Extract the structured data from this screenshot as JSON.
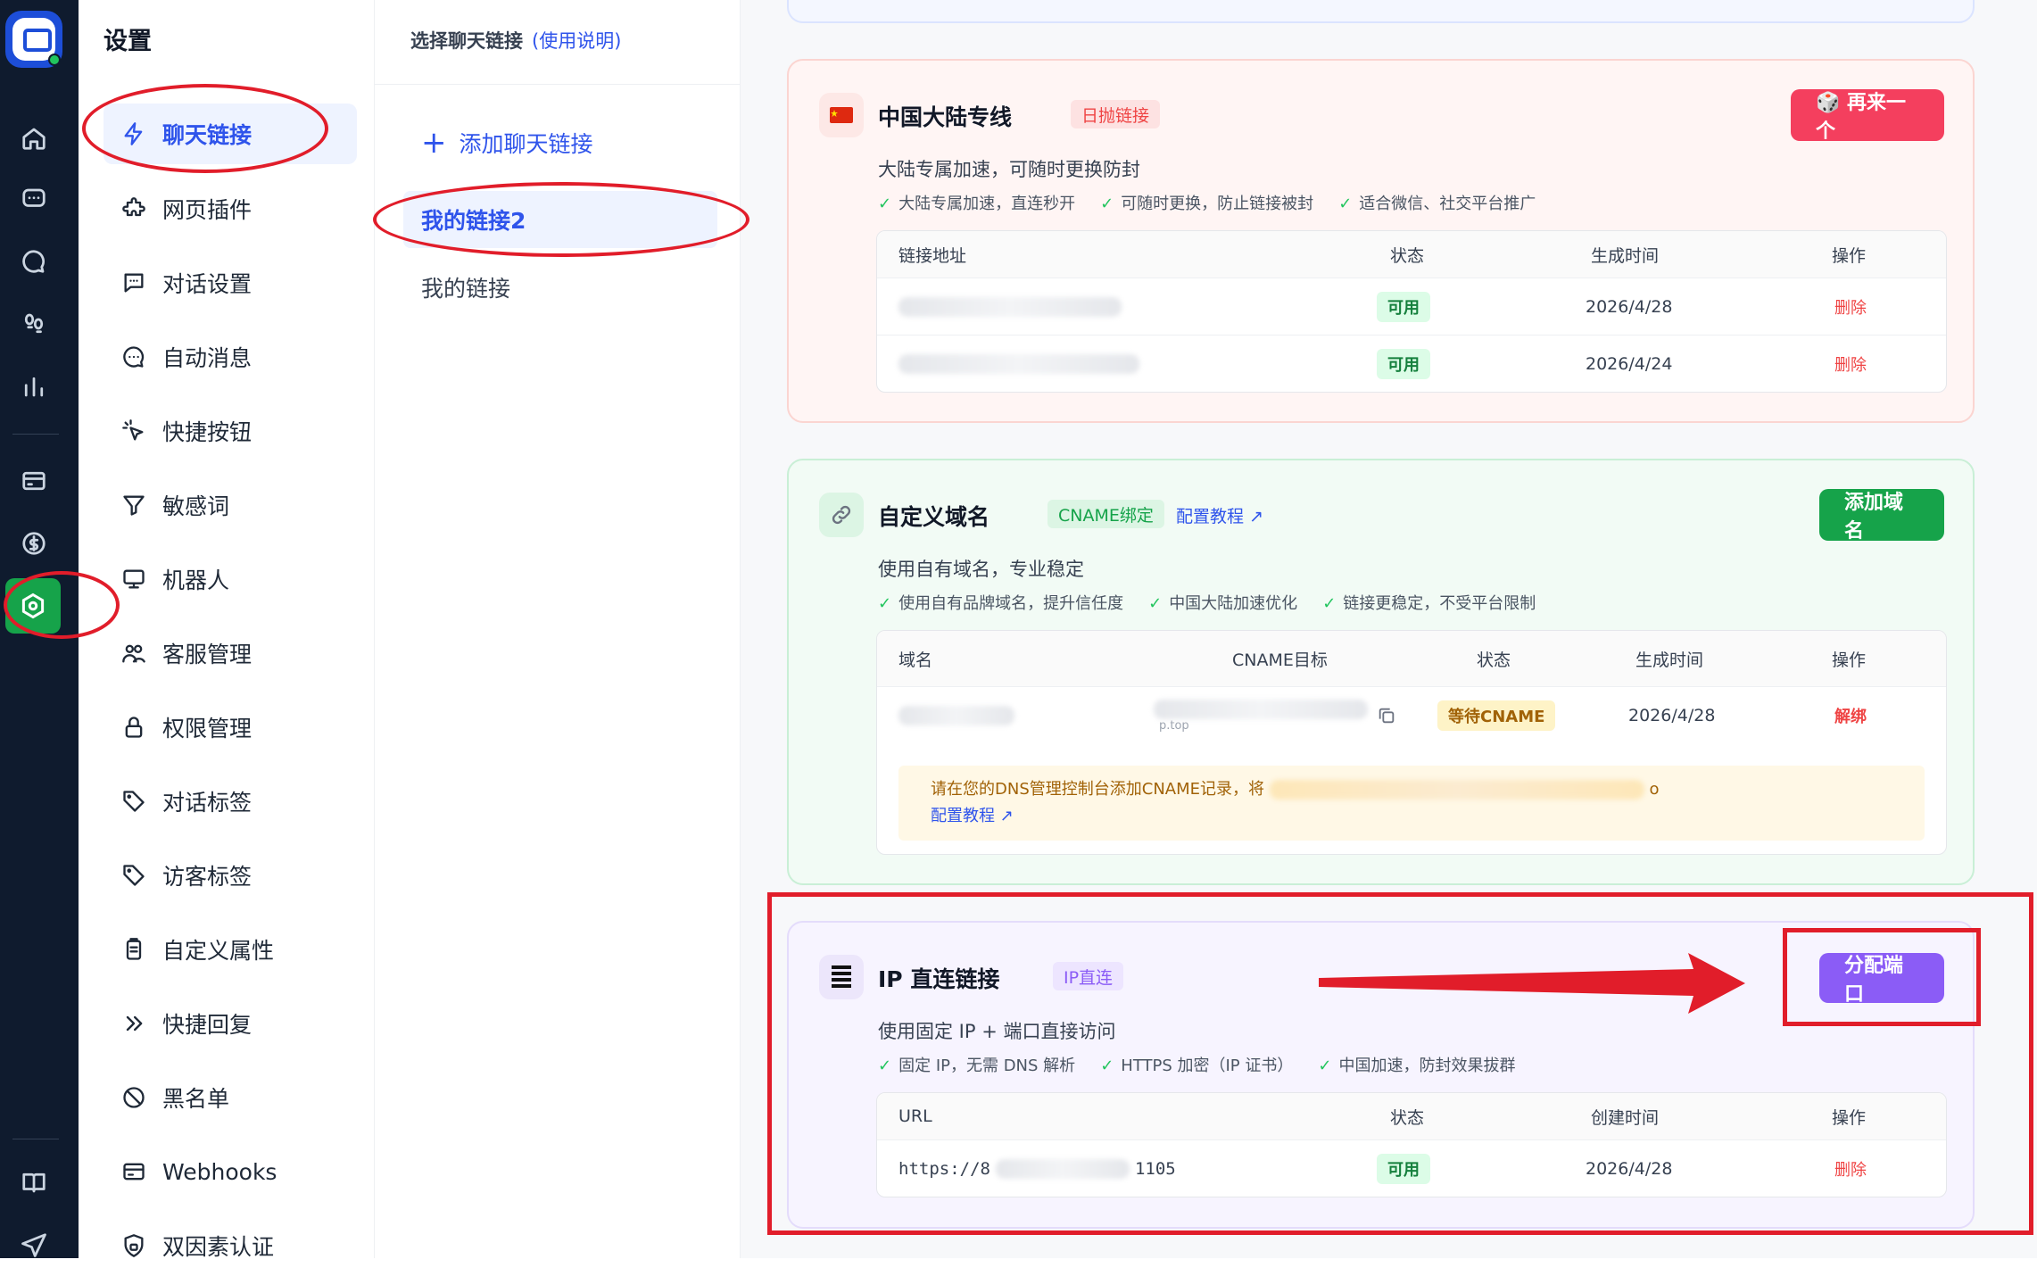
{
  "nav_rail": {
    "icons": [
      "home-icon",
      "chat-icon",
      "message-icon",
      "footprint-icon",
      "bar-chart-icon",
      "billing-icon",
      "dollar-icon",
      "settings-icon",
      "book-icon",
      "send-icon"
    ]
  },
  "settings_menu": {
    "title": "设置",
    "items": [
      {
        "label": "聊天链接",
        "icon": "bolt-icon",
        "active": true
      },
      {
        "label": "网页插件",
        "icon": "puzzle-icon"
      },
      {
        "label": "对话设置",
        "icon": "chat-settings-icon"
      },
      {
        "label": "自动消息",
        "icon": "auto-message-icon"
      },
      {
        "label": "快捷按钮",
        "icon": "cursor-click-icon"
      },
      {
        "label": "敏感词",
        "icon": "filter-icon"
      },
      {
        "label": "机器人",
        "icon": "monitor-icon"
      },
      {
        "label": "客服管理",
        "icon": "users-icon"
      },
      {
        "label": "权限管理",
        "icon": "lock-icon"
      },
      {
        "label": "对话标签",
        "icon": "tag-icon"
      },
      {
        "label": "访客标签",
        "icon": "tag-icon"
      },
      {
        "label": "自定义属性",
        "icon": "clipboard-icon"
      },
      {
        "label": "快捷回复",
        "icon": "double-chevron-icon"
      },
      {
        "label": "黑名单",
        "icon": "ban-icon"
      },
      {
        "label": "Webhooks",
        "icon": "webhook-icon"
      },
      {
        "label": "双因素认证",
        "icon": "shield-lock-icon"
      }
    ]
  },
  "links_panel": {
    "header": "选择聊天链接",
    "help": "(使用说明)",
    "add_label": "添加聊天链接",
    "add_icon": "plus-icon",
    "items": [
      {
        "label": "我的链接2",
        "active": true
      },
      {
        "label": "我的链接"
      }
    ]
  },
  "mainland": {
    "flag_icon": "china-flag-icon",
    "title": "中国大陆专线",
    "badge": "日抛链接",
    "button": "🎲 再来一个",
    "desc": "大陆专属加速，可随时更换防封",
    "features": [
      "大陆专属加速，直连秒开",
      "可随时更换，防止链接被封",
      "适合微信、社交平台推广"
    ],
    "columns": [
      "链接地址",
      "状态",
      "生成时间",
      "操作"
    ],
    "rows": [
      {
        "status": "可用",
        "date": "2026/4/28",
        "action": "删除"
      },
      {
        "status": "可用",
        "date": "2026/4/24",
        "action": "删除"
      }
    ]
  },
  "custom_domain": {
    "icon": "link-icon",
    "title": "自定义域名",
    "badge": "CNAME绑定",
    "tutorial": "配置教程",
    "button": "添加域名",
    "desc": "使用自有域名，专业稳定",
    "features": [
      "使用自有品牌域名，提升信任度",
      "中国大陆加速优化",
      "链接更稳定，不受平台限制"
    ],
    "columns": [
      "域名",
      "CNAME目标",
      "状态",
      "生成时间",
      "操作"
    ],
    "rows": [
      {
        "status": "等待CNAME",
        "date": "2026/4/28",
        "action": "解绑"
      }
    ],
    "cname_tail": "p.top",
    "notice": "请在您的DNS管理控制台添加CNAME记录，将",
    "notice_tail": "o",
    "notice_link": "配置教程"
  },
  "ip_direct": {
    "icon": "server-icon",
    "title": "IP 直连链接",
    "badge": "IP直连",
    "button": "分配端口",
    "desc": "使用固定 IP + 端口直接访问",
    "features": [
      "固定 IP，无需 DNS 解析",
      "HTTPS 加密（IP 证书）",
      "中国加速，防封效果拔群"
    ],
    "columns": [
      "URL",
      "状态",
      "创建时间",
      "操作"
    ],
    "rows": [
      {
        "url_prefix": "https://8",
        "url_suffix": "1105",
        "status": "可用",
        "date": "2026/4/28",
        "action": "删除"
      }
    ]
  },
  "colors": {
    "primary": "#2f54eb",
    "danger": "#ef4444",
    "success": "#22c55e",
    "purple": "#8b5cf6",
    "annotation": "#e11d2a"
  }
}
